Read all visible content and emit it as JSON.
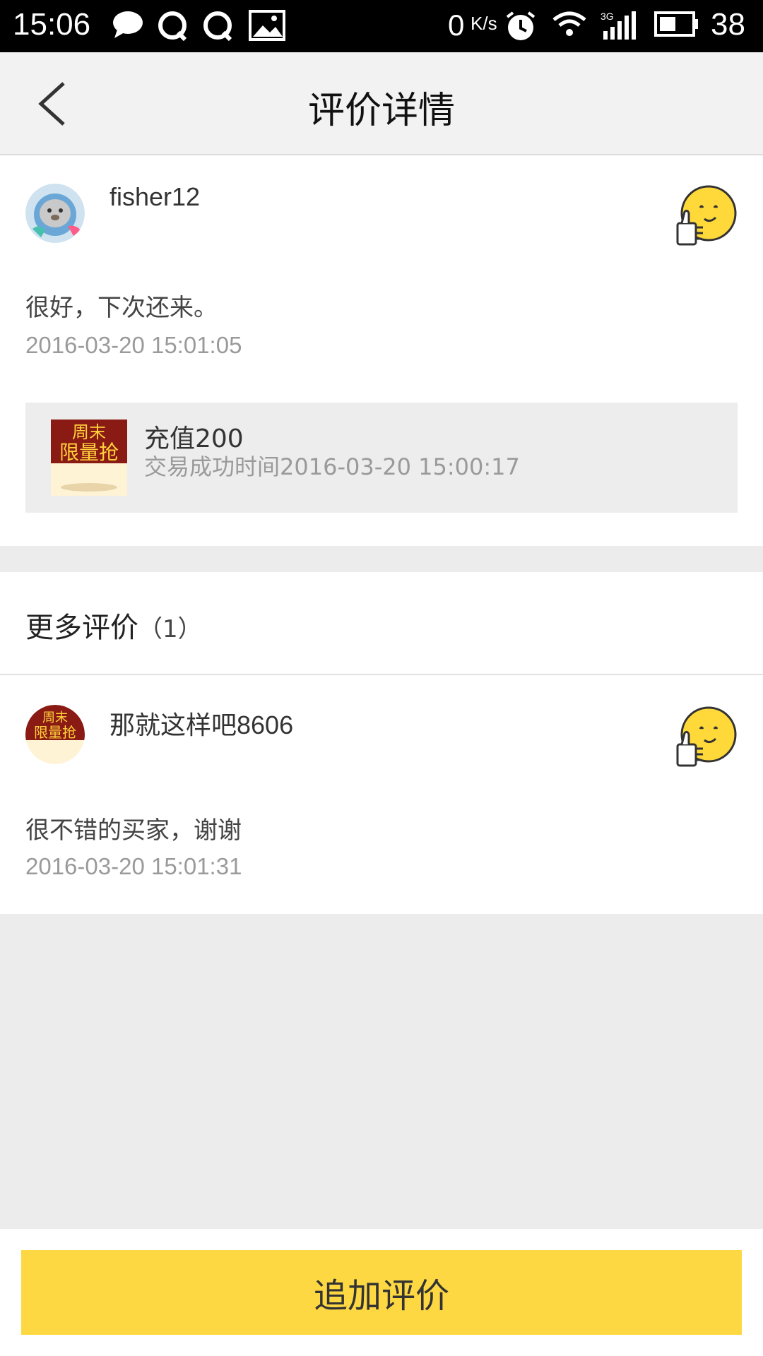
{
  "status_bar": {
    "time": "15:06",
    "net_speed": "0",
    "net_unit": "K/s",
    "battery": "38",
    "icons": [
      "chat-bubble-icon",
      "qq-icon",
      "qq-icon",
      "image-icon",
      "alarm-icon",
      "wifi-icon",
      "signal-3g-icon",
      "battery-icon"
    ]
  },
  "navbar": {
    "title": "评价详情",
    "back_icon": "chevron-left-icon"
  },
  "review": {
    "username": "fisher12",
    "comment": "很好，下次还来。",
    "date": "2016-03-20 15:01:05",
    "rating_icon": "thumbs-up-emoji-icon",
    "product": {
      "title": "充值200",
      "subtitle": "交易成功时间2016-03-20 15:00:17",
      "thumb_text_top": "周末",
      "thumb_text_bottom": "限量抢"
    }
  },
  "more": {
    "title": "更多评价",
    "count": "（1）"
  },
  "more_reviews": [
    {
      "username": "那就这样吧8606",
      "comment": "很不错的买家，谢谢",
      "date": "2016-03-20 15:01:31",
      "rating_icon": "thumbs-up-emoji-icon"
    }
  ],
  "bottom": {
    "button_label": "追加评价"
  },
  "colors": {
    "accent": "#fdd843",
    "background": "#ececec"
  }
}
